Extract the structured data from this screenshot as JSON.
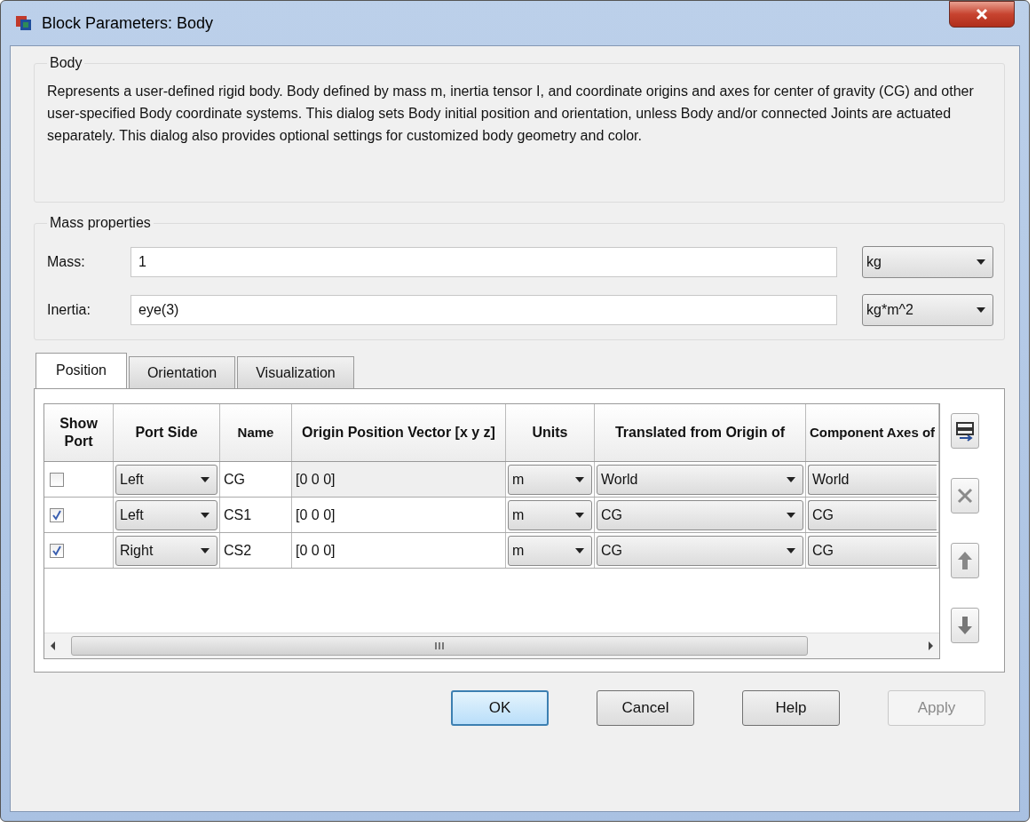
{
  "window": {
    "title": "Block Parameters: Body"
  },
  "description_group": {
    "title": "Body",
    "text": "Represents a user-defined rigid body. Body defined by mass m, inertia tensor I, and coordinate origins and axes for center of gravity (CG) and other user-specified Body coordinate systems. This dialog sets Body initial position and orientation, unless Body and/or connected Joints are actuated separately. This dialog also provides optional settings for customized body geometry and color."
  },
  "mass_properties": {
    "title": "Mass properties",
    "fields": [
      {
        "label": "Mass:",
        "value": "1",
        "unit": "kg"
      },
      {
        "label": "Inertia:",
        "value": "eye(3)",
        "unit": "kg*m^2"
      }
    ]
  },
  "tabs": [
    {
      "label": "Position",
      "selected": true
    },
    {
      "label": "Orientation",
      "selected": false
    },
    {
      "label": "Visualization",
      "selected": false
    }
  ],
  "table": {
    "columns": [
      "Show Port",
      "Port Side",
      "Name",
      "Origin Position Vector [x y z]",
      "Units",
      "Translated from Origin of",
      "Component Axes of"
    ],
    "rows": [
      {
        "show_port": false,
        "port_side": "Left",
        "name": "CG",
        "origin": "[0 0 0]",
        "units": "m",
        "translated_from": "World",
        "component_axes": "World"
      },
      {
        "show_port": true,
        "port_side": "Left",
        "name": "CS1",
        "origin": "[0 0 0]",
        "units": "m",
        "translated_from": "CG",
        "component_axes": "CG"
      },
      {
        "show_port": true,
        "port_side": "Right",
        "name": "CS2",
        "origin": "[0 0 0]",
        "units": "m",
        "translated_from": "CG",
        "component_axes": "CG"
      }
    ]
  },
  "side_buttons": [
    {
      "kind": "add"
    },
    {
      "kind": "delete"
    },
    {
      "kind": "up"
    },
    {
      "kind": "down"
    }
  ],
  "buttons": [
    {
      "label": "OK",
      "default": true,
      "disabled": false
    },
    {
      "label": "Cancel",
      "default": false,
      "disabled": false
    },
    {
      "label": "Help",
      "default": false,
      "disabled": false
    },
    {
      "label": "Apply",
      "default": false,
      "disabled": true
    }
  ]
}
